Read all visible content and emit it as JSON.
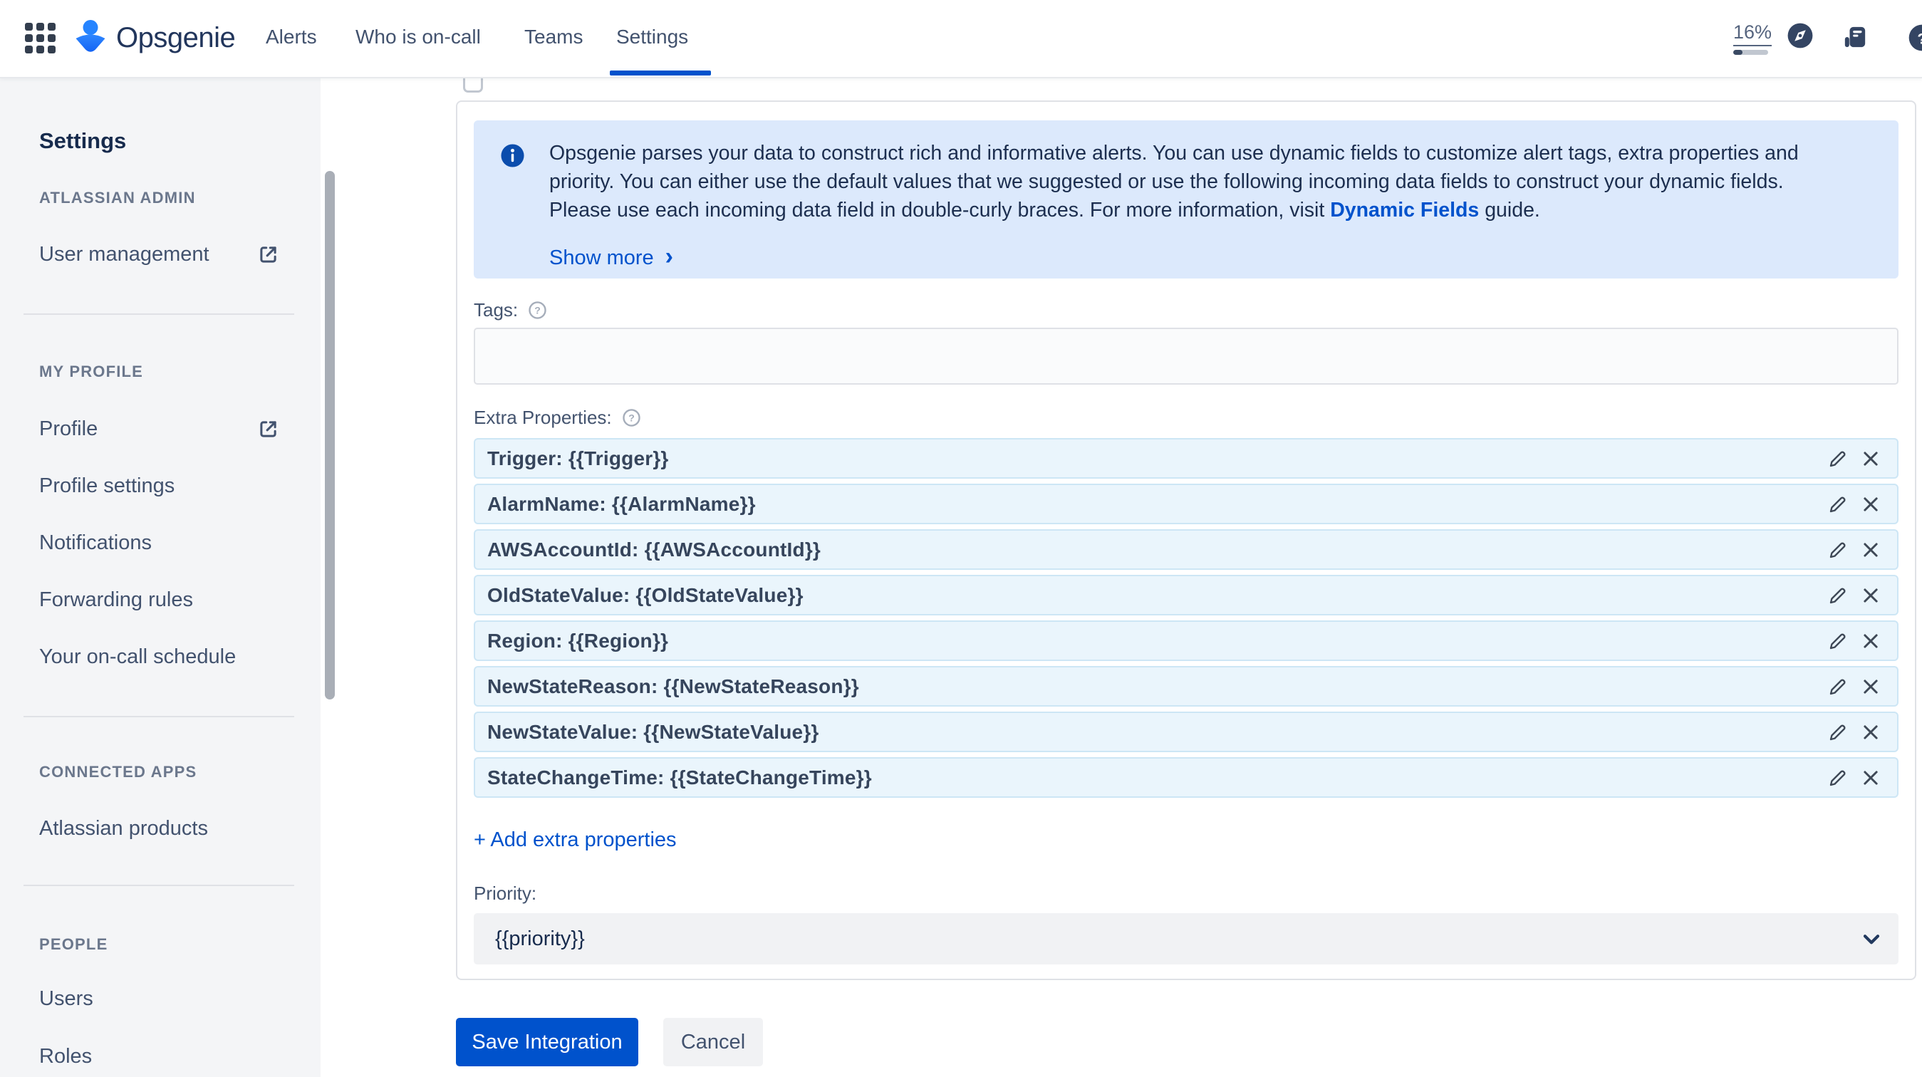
{
  "nav": {
    "brand": "Opsgenie",
    "items": [
      {
        "label": "Alerts"
      },
      {
        "label": "Who is on-call"
      },
      {
        "label": "Teams"
      },
      {
        "label": "Settings",
        "active": true
      }
    ],
    "usage": {
      "percent": "16%"
    },
    "icons": [
      "app-switcher-grid",
      "opsgenie-logo",
      "compass",
      "release-notes",
      "help"
    ]
  },
  "sidebar": {
    "title": "Settings",
    "sections": [
      {
        "header": "ATLASSIAN ADMIN",
        "items": [
          {
            "label": "User management",
            "external": true
          }
        ]
      },
      {
        "header": "MY PROFILE",
        "items": [
          {
            "label": "Profile",
            "external": true
          },
          {
            "label": "Profile settings"
          },
          {
            "label": "Notifications"
          },
          {
            "label": "Forwarding rules"
          },
          {
            "label": "Your on-call schedule"
          }
        ]
      },
      {
        "header": "CONNECTED APPS",
        "items": [
          {
            "label": "Atlassian products"
          }
        ]
      },
      {
        "header": "PEOPLE",
        "items": [
          {
            "label": "Users"
          },
          {
            "label": "Roles"
          }
        ]
      }
    ]
  },
  "main": {
    "banner": {
      "line1": "Opsgenie parses your data to construct rich and informative alerts. You can use dynamic fields to customize alert tags, extra properties and",
      "line2": "priority. You can either use the default values that we suggested or use the following incoming data fields to construct your dynamic fields.",
      "line3_pre": "Please use each incoming data field in double-curly braces. For more information, visit ",
      "line3_link": "Dynamic Fields",
      "line3_post": " guide.",
      "show_more": "Show more",
      "show_more_chevron": "›"
    },
    "tags_label": "Tags:",
    "extra_properties_label": "Extra Properties:",
    "properties": [
      "Trigger: {{Trigger}}",
      "AlarmName: {{AlarmName}}",
      "AWSAccountId: {{AWSAccountId}}",
      "OldStateValue: {{OldStateValue}}",
      "Region: {{Region}}",
      "NewStateReason: {{NewStateReason}}",
      "NewStateValue: {{NewStateValue}}",
      "StateChangeTime: {{StateChangeTime}}"
    ],
    "add_link": "+ Add extra properties",
    "priority_label": "Priority:",
    "priority_value": "{{priority}}",
    "save_label": "Save Integration",
    "cancel_label": "Cancel"
  },
  "colors": {
    "accent": "#0052CC",
    "banner_bg": "#DCE9FC",
    "property_row_bg": "#EAF5FC",
    "nav_icon": "#344563",
    "sidebar_bg": "#F4F5F7"
  }
}
